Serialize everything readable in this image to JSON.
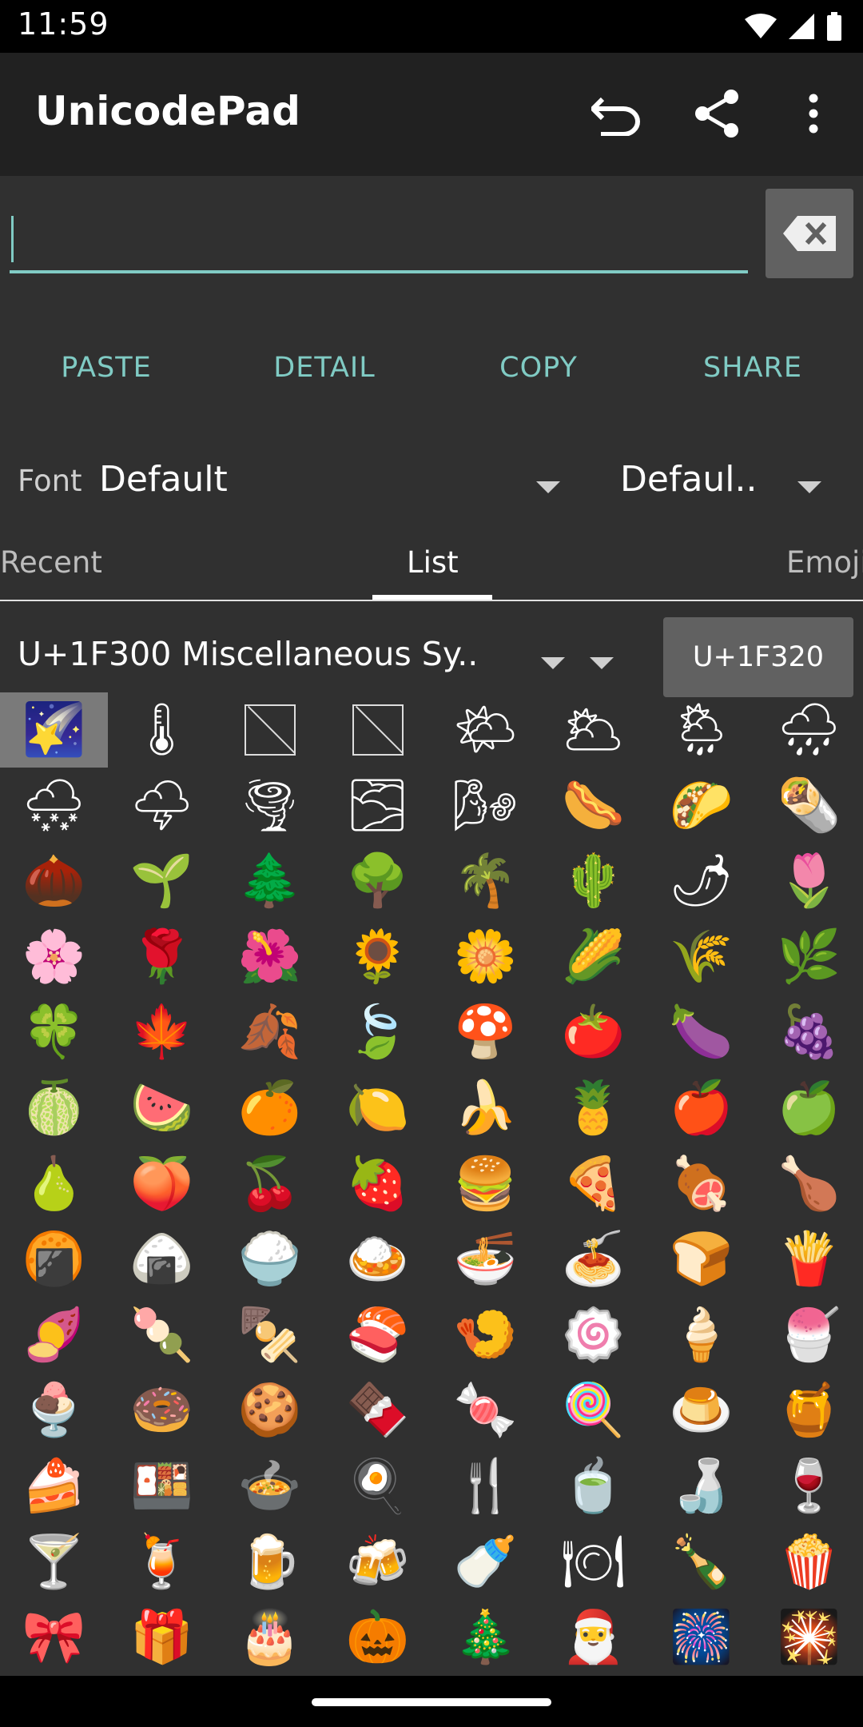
{
  "status_bar": {
    "time": "11:59"
  },
  "app_bar": {
    "title": "UnicodePad",
    "icons": [
      "undo-icon",
      "share-icon",
      "more-vert-icon"
    ]
  },
  "input": {
    "value": "",
    "delete_icon": "backspace-icon"
  },
  "actions": {
    "paste": "PASTE",
    "detail": "DETAIL",
    "copy": "COPY",
    "share": "SHARE"
  },
  "font_row": {
    "label": "Font",
    "font_value": "Default",
    "locale_value": "Defaul.."
  },
  "tabs": [
    "Recent",
    "List",
    "Emoji"
  ],
  "active_tab": "List",
  "block": {
    "selected": "U+1F300 Miscellaneous Sy..",
    "goto_label": "U+1F320"
  },
  "colors": {
    "accent": "#80cbc4",
    "background": "#303030",
    "app_bar": "#212121"
  },
  "grid": [
    [
      "🌠",
      "🌡",
      "",
      "",
      "🌤",
      "🌥",
      "🌦",
      "🌧"
    ],
    [
      "🌨",
      "🌩",
      "🌪",
      "🌫",
      "🌬",
      "🌭",
      "🌮",
      "🌯"
    ],
    [
      "🌰",
      "🌱",
      "🌲",
      "🌳",
      "🌴",
      "🌵",
      "🌶",
      "🌷"
    ],
    [
      "🌸",
      "🌹",
      "🌺",
      "🌻",
      "🌼",
      "🌽",
      "🌾",
      "🌿"
    ],
    [
      "🍀",
      "🍁",
      "🍂",
      "🍃",
      "🍄",
      "🍅",
      "🍆",
      "🍇"
    ],
    [
      "🍈",
      "🍉",
      "🍊",
      "🍋",
      "🍌",
      "🍍",
      "🍎",
      "🍏"
    ],
    [
      "🍐",
      "🍑",
      "🍒",
      "🍓",
      "🍔",
      "🍕",
      "🍖",
      "🍗"
    ],
    [
      "🍘",
      "🍙",
      "🍚",
      "🍛",
      "🍜",
      "🍝",
      "🍞",
      "🍟"
    ],
    [
      "🍠",
      "🍡",
      "🍢",
      "🍣",
      "🍤",
      "🍥",
      "🍦",
      "🍧"
    ],
    [
      "🍨",
      "🍩",
      "🍪",
      "🍫",
      "🍬",
      "🍭",
      "🍮",
      "🍯"
    ],
    [
      "🍰",
      "🍱",
      "🍲",
      "🍳",
      "🍴",
      "🍵",
      "🍶",
      "🍷"
    ],
    [
      "🍸",
      "🍹",
      "🍺",
      "🍻",
      "🍼",
      "🍽",
      "🍾",
      "🍿"
    ],
    [
      "🎀",
      "🎁",
      "🎂",
      "🎃",
      "🎄",
      "🎅",
      "🎆",
      "🎇"
    ]
  ]
}
